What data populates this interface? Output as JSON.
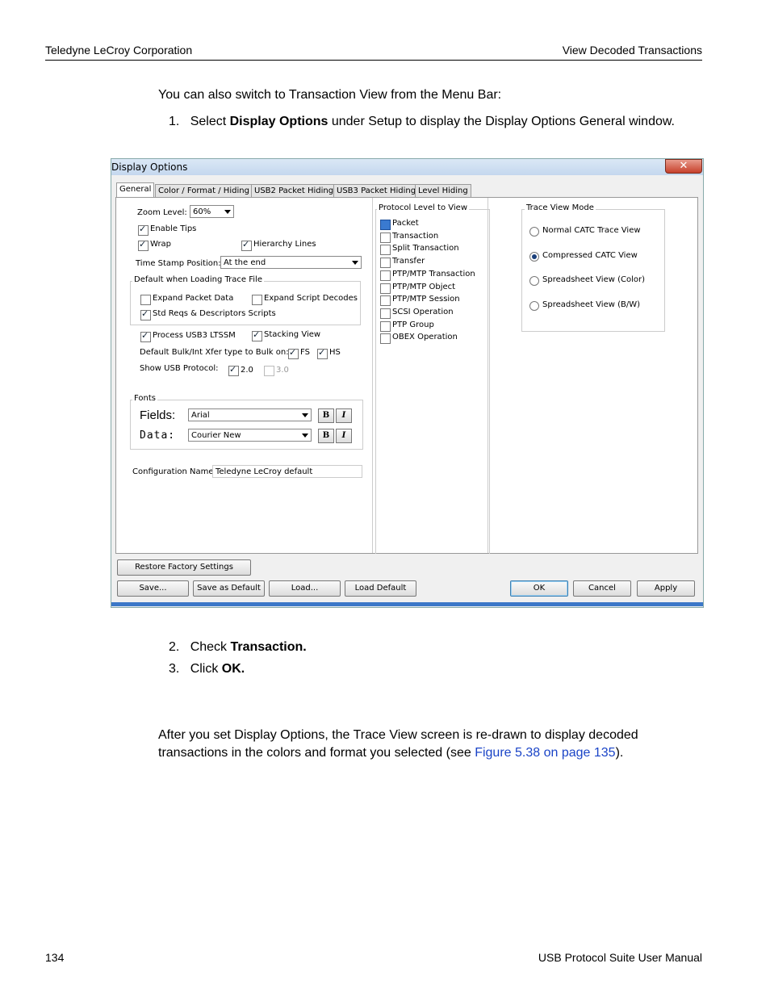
{
  "header": {
    "left": "Teledyne LeCroy Corporation",
    "right": "View Decoded Transactions"
  },
  "intro": "You can also switch to Transaction View from the Menu Bar:",
  "steps": [
    {
      "num": "1.",
      "pre": "Select ",
      "bold": "Display Options",
      "post": " under Setup to display the Display Options General window."
    },
    {
      "num": "2.",
      "pre": "Check ",
      "bold": "Transaction.",
      "post": ""
    },
    {
      "num": "3.",
      "pre": "Click ",
      "bold": "OK.",
      "post": ""
    }
  ],
  "after": {
    "pre": "After you set Display Options, the Trace View screen is re-drawn to display decoded transactions in the colors and format you selected (see ",
    "link": "Figure 5.38 on page 135",
    "post": ")."
  },
  "footer": {
    "page": "134",
    "title": "USB Protocol Suite User Manual"
  },
  "dialog": {
    "title": "Display Options",
    "close": "✕",
    "tabs": [
      "General",
      "Color / Format / Hiding",
      "USB2 Packet Hiding",
      "USB3 Packet Hiding",
      "Level Hiding"
    ],
    "zoom_label": "Zoom Level:",
    "zoom_value": "60%",
    "enable_tips": "Enable Tips",
    "wrap": "Wrap",
    "hierarchy": "Hierarchy Lines",
    "timestamp_label": "Time Stamp Position:",
    "timestamp_value": "At the end",
    "default_group": "Default when Loading Trace File",
    "expand_packet": "Expand Packet Data",
    "expand_script": "Expand Script Decodes",
    "std_reqs": "Std Reqs & Descriptors Scripts",
    "process_ltssm": "Process USB3 LTSSM",
    "stacking": "Stacking View",
    "bulk_label": "Default Bulk/Int Xfer type to Bulk on:",
    "fs": "FS",
    "hs": "HS",
    "show_usb": "Show USB Protocol:",
    "v20": "2.0",
    "v30": "3.0",
    "fonts_group": "Fonts",
    "fields_label": "Fields:",
    "data_label": "Data:",
    "fields_font": "Arial",
    "data_font": "Courier New",
    "bold_btn": "B",
    "italic_btn": "I",
    "config_label": "Configuration Name:",
    "config_value": "Teledyne LeCroy default",
    "protocol_group": "Protocol Level to View",
    "protocol_items": [
      "Packet",
      "Transaction",
      "Split Transaction",
      "Transfer",
      "PTP/MTP Transaction",
      "PTP/MTP Object",
      "PTP/MTP Session",
      "SCSI Operation",
      "PTP Group",
      "OBEX Operation"
    ],
    "trace_group": "Trace View Mode",
    "trace_modes": [
      "Normal CATC Trace View",
      "Compressed CATC View",
      "Spreadsheet View (Color)",
      "Spreadsheet View (B/W)"
    ],
    "buttons": {
      "restore": "Restore Factory Settings",
      "save": "Save...",
      "save_default": "Save as Default",
      "load": "Load...",
      "load_default": "Load Default",
      "ok": "OK",
      "cancel": "Cancel",
      "apply": "Apply"
    }
  }
}
